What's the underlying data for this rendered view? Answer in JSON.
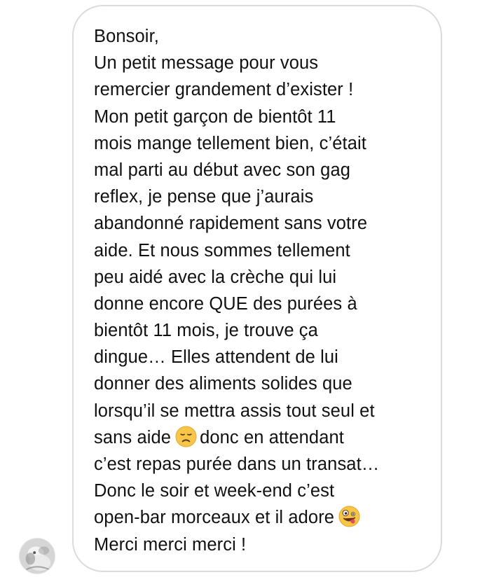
{
  "message": {
    "lines": [
      "Bonsoir,",
      "Un petit message pour vous",
      "remercier grandement d’exister !",
      "Mon petit garçon de bientôt 11",
      "mois mange tellement bien, c’était",
      "mal parti au début avec son gag",
      "reflex, je pense que j’aurais",
      "abandonné rapidement sans votre",
      "aide. Et nous sommes tellement",
      "peu aidé avec la crèche qui lui",
      "donne encore QUE des purées à",
      "bientôt 11 mois, je trouve ça",
      "dingue… Elles attendent de lui",
      "donner des aliments solides que",
      "lorsqu’il se mettra assis tout seul et"
    ],
    "line16_before": "sans aide",
    "line16_after": "donc en attendant",
    "line17": "c’est repas purée dans un transat…",
    "line18": "Donc le soir et week-end c’est",
    "line19_before": "open-bar morceaux et il adore",
    "line20": "Merci merci merci !"
  },
  "icons": {
    "sad_emoji": "disappointed-face-emoji",
    "zany_emoji": "zany-face-emoji",
    "avatar": "profile-avatar"
  },
  "colors": {
    "text": "#111111",
    "bubble_border": "#dbdbdb",
    "emoji_yellow": "#f7c548"
  }
}
